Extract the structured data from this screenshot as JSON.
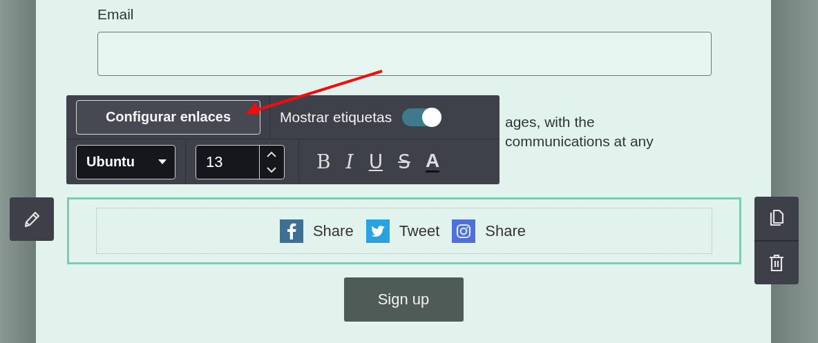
{
  "form": {
    "email": {
      "label": "Email"
    },
    "consent_text_lines": [
      "ages, with the",
      "communications at any"
    ],
    "social_block": {
      "items": [
        {
          "kind": "facebook",
          "label": "Share"
        },
        {
          "kind": "twitter",
          "label": "Tweet"
        },
        {
          "kind": "instagram",
          "label": "Share"
        }
      ]
    },
    "submit_button": "Sign up"
  },
  "toolbar": {
    "configure_button": "Configurar enlaces",
    "labels_toggle": {
      "label": "Mostrar etiquetas",
      "on": true
    },
    "font_select": {
      "value": "Ubuntu"
    },
    "font_size": {
      "value": "13"
    },
    "format_buttons": [
      {
        "kind": "bold",
        "label": "B"
      },
      {
        "kind": "italic",
        "label": "I"
      },
      {
        "kind": "underline",
        "label": "U"
      },
      {
        "kind": "strike",
        "label": "S"
      },
      {
        "kind": "color",
        "label": "A"
      }
    ]
  },
  "side_actions": {
    "left": [
      {
        "kind": "edit"
      }
    ],
    "right": [
      {
        "kind": "copy"
      },
      {
        "kind": "delete"
      }
    ]
  }
}
